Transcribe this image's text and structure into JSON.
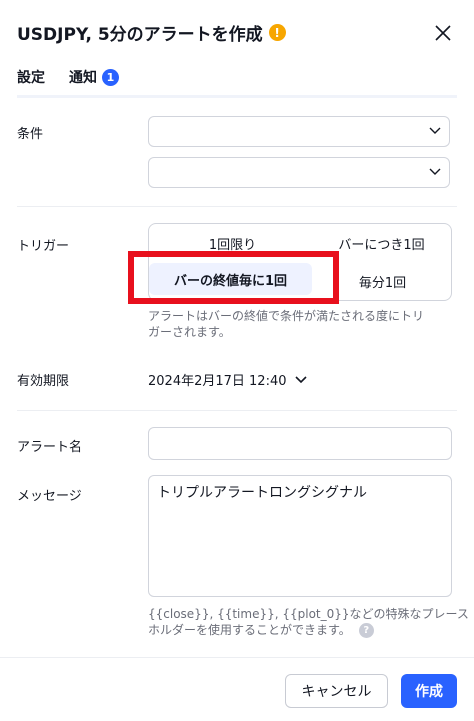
{
  "header": {
    "title": "USDJPY, 5分のアラートを作成",
    "warning_glyph": "!"
  },
  "tabs": [
    {
      "label": "設定"
    },
    {
      "label": "通知",
      "badge": "1"
    }
  ],
  "form": {
    "condition_label": "条件",
    "trigger_label": "トリガー",
    "trigger_options": {
      "once": "1回限り",
      "once_per_bar": "バーにつき1回",
      "once_per_bar_close": "バーの終値毎に1回",
      "once_per_minute": "毎分1回"
    },
    "trigger_hint_line1": "アラートはバーの終値で条件が満たされる度にトリ",
    "trigger_hint_line2": "ガーされます。",
    "expiry_label": "有効期限",
    "expiry_value": "2024年2月17日 12:40",
    "alert_name_label": "アラート名",
    "alert_name_value": "",
    "message_label": "メッセージ",
    "message_value": "トリプルアラートロングシグナル",
    "placeholder_hint_line1": "{{close}}, {{time}}, {{plot_0}}などの特殊なプレース",
    "placeholder_hint_line2": "ホルダーを使用することができます。",
    "help_glyph": "?"
  },
  "footer": {
    "cancel_label": "キャンセル",
    "create_label": "作成"
  },
  "colors": {
    "accent": "#2962ff",
    "warning": "#f7a600",
    "highlight_box": "#e8101d"
  }
}
